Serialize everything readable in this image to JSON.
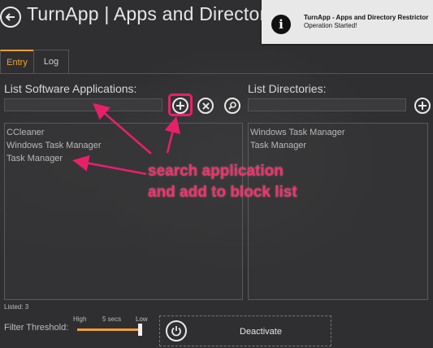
{
  "header": {
    "title": "TurnApp | Apps and Directory Restrict",
    "back_icon": "back-arrow-icon"
  },
  "toast": {
    "icon": "info-icon",
    "icon_glyph": "i",
    "title": "TurnApp - Apps and Directory Restrictor",
    "message": "Operation Started!"
  },
  "tabs": [
    {
      "label": "Entry",
      "active": true
    },
    {
      "label": "Log",
      "active": false
    }
  ],
  "software": {
    "label": "List Software Applications:",
    "search_placeholder": "",
    "add_icon": "plus-icon",
    "remove_icon": "close-icon",
    "search_icon": "magnifier-icon",
    "items": [
      "CCleaner",
      "Windows Task Manager",
      "Task Manager"
    ]
  },
  "directories": {
    "label": "List Directories:",
    "add_icon": "plus-icon",
    "items": [
      "Windows Task Manager",
      "Task Manager"
    ]
  },
  "footer": {
    "listed": "Listed: 3",
    "filter_label": "Filter Threshold:",
    "tick_high": "High",
    "tick_mid": "5 secs",
    "tick_low": "Low",
    "slider_level": 0.98,
    "deactivate_label": "Deactivate",
    "power_icon": "power-icon"
  },
  "annotation": {
    "line1": "search application",
    "line2": "and add to block list",
    "color": "#ff2d6b"
  },
  "colors": {
    "accent": "#f0a030",
    "background": "#2f2f31",
    "annotation": "#e8206a"
  }
}
